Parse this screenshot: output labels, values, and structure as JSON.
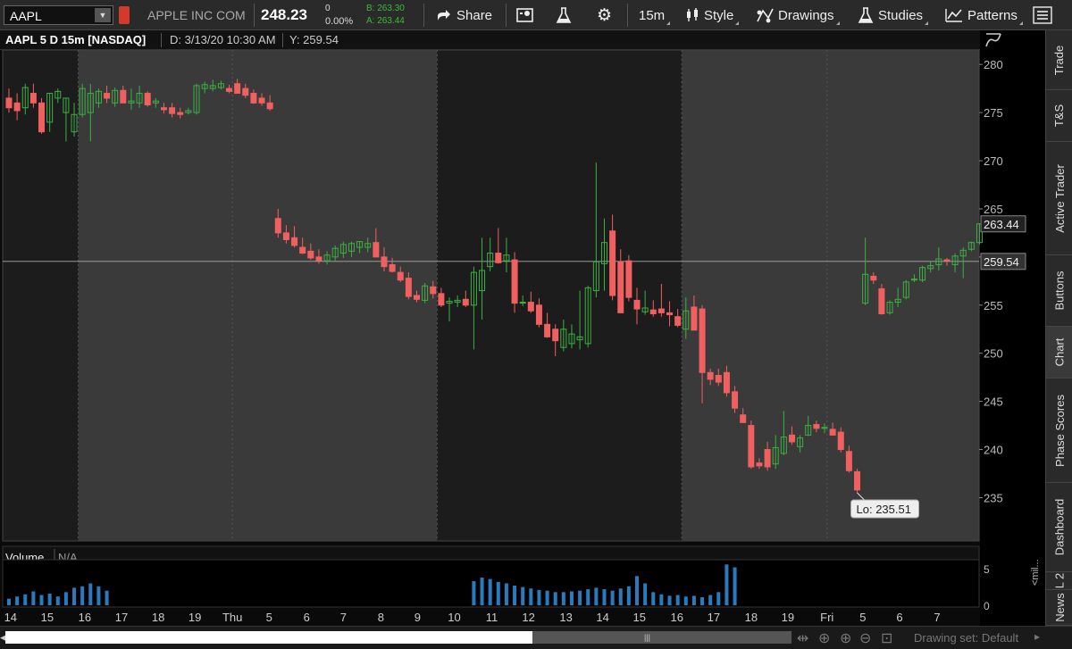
{
  "toolbar": {
    "symbol": "AAPL",
    "company": "APPLE INC COM",
    "last_price": "248.23",
    "net_change": "0",
    "pct_change": "0.00%",
    "bid": "B: 263.30",
    "ask": "A: 263.44",
    "share_label": "Share",
    "interval_label": "15m",
    "style_label": "Style",
    "drawings_label": "Drawings",
    "studies_label": "Studies",
    "patterns_label": "Patterns"
  },
  "chart_header": {
    "title": "AAPL 5 D 15m [NASDAQ]",
    "date_readout": "D: 3/13/20 10:30 AM",
    "y_readout": "Y: 259.54"
  },
  "chart_data": {
    "type": "candlestick",
    "y_ticks": [
      280,
      275,
      270,
      265,
      260,
      255,
      250,
      245,
      240,
      235
    ],
    "ylim": [
      230.5,
      281.5
    ],
    "x_labels": [
      "14",
      "15",
      "16",
      "17",
      "18",
      "19",
      "Thu",
      "5",
      "6",
      "7",
      "8",
      "9",
      "10",
      "11",
      "12",
      "13",
      "14",
      "15",
      "16",
      "17",
      "18",
      "19",
      "Fri",
      "5",
      "6",
      "7"
    ],
    "crosshair_y": 259.54,
    "crosshair_label": "259.54",
    "last_label": "263.44",
    "last_value": 263.44,
    "low_label": "Lo: 235.51",
    "low_value": 235.51,
    "candles": [
      [
        276.5,
        277.5,
        275.0,
        275.5
      ],
      [
        276.0,
        277.0,
        274.2,
        275.2
      ],
      [
        275.5,
        278.0,
        274.8,
        277.6
      ],
      [
        277.0,
        278.0,
        275.5,
        276.0
      ],
      [
        276.0,
        276.5,
        272.8,
        273.0
      ],
      [
        274.0,
        277.0,
        273.0,
        277.0
      ],
      [
        276.5,
        277.5,
        276.0,
        277.2
      ],
      [
        275.0,
        276.5,
        272.0,
        276.5
      ],
      [
        273.0,
        276.0,
        272.5,
        274.8
      ],
      [
        274.8,
        278.0,
        274.5,
        277.5
      ],
      [
        275.0,
        278.0,
        272.0,
        277.0
      ],
      [
        276.0,
        277.5,
        275.5,
        277.2
      ],
      [
        277.0,
        277.8,
        276.0,
        276.5
      ],
      [
        276.0,
        277.6,
        275.6,
        277.3
      ],
      [
        277.3,
        277.8,
        276.0,
        276.0
      ],
      [
        276.0,
        277.5,
        275.3,
        276.2
      ],
      [
        276.0,
        277.8,
        275.5,
        277.0
      ],
      [
        277.0,
        277.2,
        275.6,
        275.8
      ],
      [
        276.0,
        276.5,
        275.5,
        276.2
      ],
      [
        275.5,
        276.0,
        274.9,
        275.3
      ],
      [
        275.5,
        276.0,
        274.5,
        274.9
      ],
      [
        275.0,
        275.5,
        274.4,
        274.8
      ],
      [
        275.0,
        275.5,
        274.8,
        275.2
      ],
      [
        275.0,
        278.0,
        274.8,
        277.8
      ],
      [
        277.5,
        278.2,
        277.0,
        277.9
      ],
      [
        277.5,
        278.4,
        277.2,
        277.8
      ],
      [
        277.6,
        278.3,
        277.4,
        278.0
      ],
      [
        277.5,
        277.9,
        277.0,
        277.2
      ],
      [
        278.0,
        278.5,
        277.0,
        277.0
      ],
      [
        277.5,
        278.0,
        276.5,
        276.8
      ],
      [
        277.0,
        277.4,
        275.9,
        276.0
      ],
      [
        276.5,
        277.0,
        275.7,
        276.0
      ],
      [
        276.0,
        276.8,
        275.2,
        275.4
      ],
      [
        264.0,
        265.0,
        262.0,
        262.5
      ],
      [
        262.5,
        263.3,
        261.4,
        261.8
      ],
      [
        262.0,
        263.2,
        261.0,
        261.2
      ],
      [
        261.0,
        262.0,
        260.3,
        260.4
      ],
      [
        260.6,
        261.4,
        259.7,
        259.9
      ],
      [
        260.0,
        260.8,
        259.3,
        259.6
      ],
      [
        259.6,
        260.6,
        259.2,
        260.2
      ],
      [
        260.0,
        261.2,
        259.6,
        260.9
      ],
      [
        260.4,
        261.6,
        259.9,
        261.3
      ],
      [
        260.6,
        261.6,
        260.0,
        261.4
      ],
      [
        261.0,
        261.6,
        260.4,
        261.6
      ],
      [
        261.0,
        262.0,
        260.5,
        261.4
      ],
      [
        261.5,
        263.0,
        260.0,
        260.0
      ],
      [
        260.0,
        261.0,
        258.5,
        259.0
      ],
      [
        259.2,
        259.9,
        258.4,
        258.5
      ],
      [
        258.4,
        259.0,
        257.4,
        257.6
      ],
      [
        257.8,
        258.4,
        255.6,
        255.9
      ],
      [
        256.0,
        256.5,
        255.3,
        255.6
      ],
      [
        255.5,
        257.3,
        255.2,
        257.0
      ],
      [
        256.9,
        257.5,
        255.7,
        256.2
      ],
      [
        256.2,
        256.8,
        254.8,
        255.0
      ],
      [
        255.2,
        255.8,
        253.3,
        255.4
      ],
      [
        255.3,
        256.0,
        254.8,
        255.5
      ],
      [
        255.6,
        256.5,
        254.8,
        255.0
      ],
      [
        255.0,
        259.0,
        250.4,
        258.4
      ],
      [
        256.5,
        262.0,
        253.5,
        258.6
      ],
      [
        259.0,
        262.0,
        258.5,
        260.4
      ],
      [
        260.4,
        263.0,
        259.3,
        259.4
      ],
      [
        259.6,
        262.0,
        258.4,
        260.2
      ],
      [
        259.7,
        260.5,
        254.2,
        255.2
      ],
      [
        255.3,
        256.0,
        254.9,
        255.3
      ],
      [
        255.3,
        256.4,
        254.2,
        254.4
      ],
      [
        255.0,
        255.7,
        252.7,
        253.0
      ],
      [
        253.0,
        254.2,
        251.6,
        251.7
      ],
      [
        252.5,
        253.0,
        249.7,
        251.3
      ],
      [
        250.6,
        253.5,
        250.2,
        252.5
      ],
      [
        251.0,
        253.0,
        250.5,
        252.0
      ],
      [
        251.4,
        256.5,
        250.4,
        251.7
      ],
      [
        251.0,
        257.0,
        250.6,
        256.8
      ],
      [
        256.5,
        269.8,
        255.8,
        259.5
      ],
      [
        259.3,
        264.0,
        256.5,
        261.5
      ],
      [
        262.7,
        264.4,
        255.5,
        256.0
      ],
      [
        259.5,
        260.8,
        254.2,
        254.2
      ],
      [
        259.6,
        260.2,
        255.4,
        255.8
      ],
      [
        255.5,
        256.8,
        253.0,
        254.6
      ],
      [
        254.3,
        256.5,
        254.0,
        254.7
      ],
      [
        254.5,
        255.5,
        253.8,
        254.1
      ],
      [
        254.6,
        257.2,
        253.8,
        254.2
      ],
      [
        254.2,
        255.4,
        252.8,
        254.0
      ],
      [
        253.8,
        254.6,
        252.7,
        252.9
      ],
      [
        252.5,
        255.8,
        251.5,
        254.4
      ],
      [
        254.8,
        256.0,
        252.4,
        252.4
      ],
      [
        254.6,
        255.0,
        244.8,
        248.0
      ],
      [
        248.0,
        248.4,
        246.7,
        247.3
      ],
      [
        247.7,
        248.4,
        246.6,
        247.0
      ],
      [
        248.0,
        248.7,
        245.5,
        245.9
      ],
      [
        246.0,
        246.6,
        243.8,
        244.3
      ],
      [
        243.6,
        244.3,
        242.8,
        242.8
      ],
      [
        242.5,
        243.0,
        238.0,
        238.2
      ],
      [
        238.6,
        239.1,
        238.0,
        238.3
      ],
      [
        240.0,
        240.8,
        237.8,
        238.2
      ],
      [
        238.5,
        241.5,
        238.0,
        240.2
      ],
      [
        239.6,
        244.0,
        239.4,
        241.3
      ],
      [
        241.5,
        242.4,
        240.5,
        240.8
      ],
      [
        240.3,
        241.5,
        239.7,
        241.2
      ],
      [
        241.5,
        243.5,
        241.4,
        242.5
      ],
      [
        242.6,
        243.0,
        241.8,
        242.2
      ],
      [
        242.2,
        242.7,
        241.7,
        242.3
      ],
      [
        242.1,
        242.8,
        241.5,
        241.5
      ],
      [
        241.8,
        242.3,
        239.7,
        240.0
      ],
      [
        239.8,
        240.4,
        237.6,
        237.8
      ],
      [
        237.7,
        238.0,
        235.51,
        235.8
      ],
      [
        255.2,
        262.0,
        255.0,
        258.2
      ],
      [
        258.0,
        258.4,
        257.2,
        257.6
      ],
      [
        256.7,
        257.2,
        254.0,
        254.1
      ],
      [
        254.2,
        255.5,
        254.0,
        255.3
      ],
      [
        255.3,
        256.8,
        254.8,
        255.6
      ],
      [
        255.8,
        257.6,
        255.6,
        257.4
      ],
      [
        257.6,
        258.2,
        257.4,
        257.7
      ],
      [
        257.6,
        259.1,
        257.4,
        258.9
      ],
      [
        258.8,
        259.6,
        258.4,
        259.1
      ],
      [
        259.2,
        261.0,
        258.6,
        259.8
      ],
      [
        259.7,
        259.9,
        259.1,
        259.6
      ],
      [
        259.2,
        260.4,
        258.4,
        260.1
      ],
      [
        260.1,
        261.0,
        257.8,
        260.7
      ],
      [
        260.8,
        261.6,
        260.6,
        261.5
      ],
      [
        261.5,
        263.5,
        261.3,
        263.44
      ]
    ],
    "volume_panel": {
      "title": "Volume",
      "title_value": "N/A",
      "y_ticks": [
        5,
        0
      ],
      "ylim": [
        0,
        6
      ],
      "unit_label": "<mil...",
      "bars": [
        0.9,
        1.2,
        1.5,
        1.9,
        1.4,
        1.6,
        1.2,
        1.8,
        2.4,
        2.6,
        3.0,
        2.6,
        2.0,
        0,
        0,
        0,
        0,
        0,
        0,
        0,
        0,
        0,
        0,
        0,
        0,
        0,
        0,
        0,
        0,
        0,
        0,
        0,
        0,
        0,
        0,
        0,
        0,
        0,
        0,
        0,
        0,
        0,
        0,
        0,
        0,
        0,
        0,
        0,
        0,
        0,
        0,
        0,
        0,
        0,
        0,
        0,
        0,
        3.3,
        3.8,
        3.6,
        3.2,
        3.0,
        2.7,
        2.5,
        2.3,
        2.1,
        2.0,
        1.8,
        1.8,
        1.9,
        2.0,
        2.2,
        2.4,
        2.2,
        2.0,
        2.3,
        2.6,
        4.0,
        3.0,
        1.8,
        1.5,
        1.3,
        1.4,
        1.2,
        1.3,
        1.1,
        1.4,
        1.8,
        5.6,
        5.2,
        0,
        0,
        0,
        0,
        0,
        0,
        0,
        0,
        0,
        0,
        0,
        0,
        0,
        0,
        0,
        0,
        0,
        0,
        0,
        0,
        0,
        0,
        0,
        0,
        0,
        0,
        0,
        0,
        0,
        0,
        0,
        0
      ]
    }
  },
  "sidebar": {
    "tabs": [
      "Trade",
      "T&S",
      "Active Trader",
      "Buttons",
      "Chart",
      "Phase Scores",
      "Dashboard",
      "L 2",
      "News"
    ]
  },
  "bottom_bar": {
    "drawing_set": "Drawing set: Default"
  },
  "colors": {
    "up": "#3cb043",
    "down": "#f06060",
    "volume": "#2a7bbd",
    "ext_hours_bg": "#1c1c1c",
    "session_bg": "#3a3a3a"
  }
}
